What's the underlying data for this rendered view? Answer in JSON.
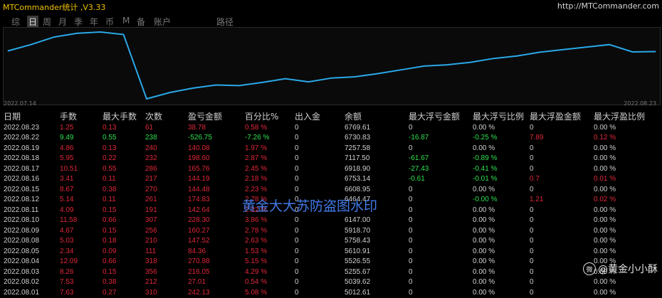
{
  "app": {
    "title": "MTCommander统计 ,V3.33",
    "url": "http://MTCommander.com"
  },
  "tabs": [
    {
      "label": "综",
      "active": false
    },
    {
      "label": "日",
      "active": true
    },
    {
      "label": "周",
      "active": false
    },
    {
      "label": "月",
      "active": false
    },
    {
      "label": "季",
      "active": false
    },
    {
      "label": "年",
      "active": false
    },
    {
      "label": "币",
      "active": false
    },
    {
      "label": "M",
      "active": false
    },
    {
      "label": "备",
      "active": false
    },
    {
      "label": "账户",
      "active": false
    },
    {
      "label": "路径",
      "active": false
    }
  ],
  "chart_data": {
    "type": "line",
    "x": [
      "2022.07.14",
      "2022.07.15",
      "2022.07.18",
      "2022.07.19",
      "2022.07.20",
      "2022.07.21",
      "2022.07.22",
      "2022.07.25",
      "2022.07.26",
      "2022.07.27",
      "2022.07.28",
      "2022.07.29",
      "2022.08.01",
      "2022.08.02",
      "2022.08.03",
      "2022.08.04",
      "2022.08.05",
      "2022.08.08",
      "2022.08.09",
      "2022.08.10",
      "2022.08.11",
      "2022.08.12",
      "2022.08.15",
      "2022.08.16",
      "2022.08.17",
      "2022.08.18",
      "2022.08.19",
      "2022.08.22",
      "2022.08.23"
    ],
    "values": [
      4750,
      4800,
      4860,
      4890,
      4900,
      4880,
      4370,
      4420,
      4455,
      4480,
      4475,
      4500,
      4530,
      4505,
      4535,
      4545,
      4570,
      4600,
      4630,
      4640,
      4660,
      4690,
      4710,
      4740,
      4760,
      4780,
      4800,
      4742,
      4745
    ],
    "x_start_label": "2022.07.14",
    "x_end_label": "2022.08.23",
    "color": "#2aa8e8",
    "grid": false
  },
  "table": {
    "headers": [
      "日期",
      "手数",
      "最大手数",
      "次数",
      "盈亏金额",
      "百分比%",
      "出入金",
      "余额",
      "最大浮亏金额",
      "最大浮亏比例",
      "最大浮盈金额",
      "最大浮盈比例"
    ],
    "rows": [
      [
        {
          "t": "2022.08.23",
          "c": "date"
        },
        {
          "t": "1.25",
          "c": "red"
        },
        {
          "t": "0.13",
          "c": "red"
        },
        {
          "t": "61",
          "c": "red"
        },
        {
          "t": "38.78",
          "c": "red"
        },
        {
          "t": "0.58 %",
          "c": "red"
        },
        {
          "t": "0",
          "c": "white"
        },
        {
          "t": "6769.61",
          "c": "white"
        },
        {
          "t": "0",
          "c": "white"
        },
        {
          "t": "0.00 %",
          "c": "white"
        },
        {
          "t": "0",
          "c": "white"
        },
        {
          "t": "0.00 %",
          "c": "white"
        }
      ],
      [
        {
          "t": "2022.08.22",
          "c": "date"
        },
        {
          "t": "9.49",
          "c": "green"
        },
        {
          "t": "0.55",
          "c": "green"
        },
        {
          "t": "238",
          "c": "green"
        },
        {
          "t": "-526.75",
          "c": "green"
        },
        {
          "t": "-7.26 %",
          "c": "green"
        },
        {
          "t": "0",
          "c": "white"
        },
        {
          "t": "6730.83",
          "c": "white"
        },
        {
          "t": "-16.87",
          "c": "green"
        },
        {
          "t": "-0.25 %",
          "c": "green"
        },
        {
          "t": "7.89",
          "c": "red"
        },
        {
          "t": "0.12 %",
          "c": "red"
        }
      ],
      [
        {
          "t": "2022.08.19",
          "c": "date"
        },
        {
          "t": "4.86",
          "c": "red"
        },
        {
          "t": "0.13",
          "c": "red"
        },
        {
          "t": "240",
          "c": "red"
        },
        {
          "t": "140.08",
          "c": "red"
        },
        {
          "t": "1.97 %",
          "c": "red"
        },
        {
          "t": "0",
          "c": "white"
        },
        {
          "t": "7257.58",
          "c": "white"
        },
        {
          "t": "0",
          "c": "white"
        },
        {
          "t": "0.00 %",
          "c": "white"
        },
        {
          "t": "0",
          "c": "white"
        },
        {
          "t": "0.00 %",
          "c": "white"
        }
      ],
      [
        {
          "t": "2022.08.18",
          "c": "date"
        },
        {
          "t": "5.95",
          "c": "red"
        },
        {
          "t": "0.22",
          "c": "red"
        },
        {
          "t": "232",
          "c": "red"
        },
        {
          "t": "198.60",
          "c": "red"
        },
        {
          "t": "2.87 %",
          "c": "red"
        },
        {
          "t": "0",
          "c": "white"
        },
        {
          "t": "7117.50",
          "c": "white"
        },
        {
          "t": "-61.67",
          "c": "green"
        },
        {
          "t": "-0.89 %",
          "c": "green"
        },
        {
          "t": "0",
          "c": "white"
        },
        {
          "t": "0.00 %",
          "c": "white"
        }
      ],
      [
        {
          "t": "2022.08.17",
          "c": "date"
        },
        {
          "t": "10.51",
          "c": "red"
        },
        {
          "t": "0.55",
          "c": "red"
        },
        {
          "t": "286",
          "c": "red"
        },
        {
          "t": "165.76",
          "c": "red"
        },
        {
          "t": "2.45 %",
          "c": "red"
        },
        {
          "t": "0",
          "c": "white"
        },
        {
          "t": "6918.90",
          "c": "white"
        },
        {
          "t": "-27.43",
          "c": "green"
        },
        {
          "t": "-0.41 %",
          "c": "green"
        },
        {
          "t": "0",
          "c": "white"
        },
        {
          "t": "0.00 %",
          "c": "white"
        }
      ],
      [
        {
          "t": "2022.08.16",
          "c": "date"
        },
        {
          "t": "3.41",
          "c": "red"
        },
        {
          "t": "0.11",
          "c": "red"
        },
        {
          "t": "217",
          "c": "red"
        },
        {
          "t": "144.19",
          "c": "red"
        },
        {
          "t": "2.18 %",
          "c": "red"
        },
        {
          "t": "0",
          "c": "white"
        },
        {
          "t": "6753.14",
          "c": "white"
        },
        {
          "t": "-0.61",
          "c": "green"
        },
        {
          "t": "-0.01 %",
          "c": "green"
        },
        {
          "t": "0.7",
          "c": "red"
        },
        {
          "t": "0.01 %",
          "c": "red"
        }
      ],
      [
        {
          "t": "2022.08.15",
          "c": "date"
        },
        {
          "t": "8.67",
          "c": "red"
        },
        {
          "t": "0.38",
          "c": "red"
        },
        {
          "t": "270",
          "c": "red"
        },
        {
          "t": "144.48",
          "c": "red"
        },
        {
          "t": "2.23 %",
          "c": "red"
        },
        {
          "t": "0",
          "c": "white"
        },
        {
          "t": "6608.95",
          "c": "white"
        },
        {
          "t": "0",
          "c": "white"
        },
        {
          "t": "0.00 %",
          "c": "white"
        },
        {
          "t": "0",
          "c": "white"
        },
        {
          "t": "0.00 %",
          "c": "white"
        }
      ],
      [
        {
          "t": "2022.08.12",
          "c": "date"
        },
        {
          "t": "5.14",
          "c": "red"
        },
        {
          "t": "0.11",
          "c": "red"
        },
        {
          "t": "261",
          "c": "red"
        },
        {
          "t": "174.83",
          "c": "red"
        },
        {
          "t": "2.78 %",
          "c": "red"
        },
        {
          "t": "0",
          "c": "white"
        },
        {
          "t": "6464.47",
          "c": "white"
        },
        {
          "t": "0",
          "c": "white"
        },
        {
          "t": "-0.00 %",
          "c": "green"
        },
        {
          "t": "1.21",
          "c": "red"
        },
        {
          "t": "0.02 %",
          "c": "red"
        }
      ],
      [
        {
          "t": "2022.08.11",
          "c": "date"
        },
        {
          "t": "4.09",
          "c": "red"
        },
        {
          "t": "0.15",
          "c": "red"
        },
        {
          "t": "191",
          "c": "red"
        },
        {
          "t": "142.64",
          "c": "red"
        },
        {
          "t": "2.32 %",
          "c": "red"
        },
        {
          "t": "0",
          "c": "white"
        },
        {
          "t": "",
          "c": "white"
        },
        {
          "t": "0",
          "c": "white"
        },
        {
          "t": "0.00 %",
          "c": "white"
        },
        {
          "t": "0",
          "c": "white"
        },
        {
          "t": "0.00 %",
          "c": "white"
        }
      ],
      [
        {
          "t": "2022.08.10",
          "c": "date"
        },
        {
          "t": "11.58",
          "c": "red"
        },
        {
          "t": "0.66",
          "c": "red"
        },
        {
          "t": "307",
          "c": "red"
        },
        {
          "t": "228.30",
          "c": "red"
        },
        {
          "t": "3.86 %",
          "c": "red"
        },
        {
          "t": "0",
          "c": "white"
        },
        {
          "t": "6147.00",
          "c": "white"
        },
        {
          "t": "0",
          "c": "white"
        },
        {
          "t": "0.00 %",
          "c": "white"
        },
        {
          "t": "0",
          "c": "white"
        },
        {
          "t": "0.00 %",
          "c": "white"
        }
      ],
      [
        {
          "t": "2022.08.09",
          "c": "date"
        },
        {
          "t": "4.67",
          "c": "red"
        },
        {
          "t": "0.15",
          "c": "red"
        },
        {
          "t": "256",
          "c": "red"
        },
        {
          "t": "160.27",
          "c": "red"
        },
        {
          "t": "2.78 %",
          "c": "red"
        },
        {
          "t": "0",
          "c": "white"
        },
        {
          "t": "5918.70",
          "c": "white"
        },
        {
          "t": "0",
          "c": "white"
        },
        {
          "t": "0.00 %",
          "c": "white"
        },
        {
          "t": "0",
          "c": "white"
        },
        {
          "t": "0.00 %",
          "c": "white"
        }
      ],
      [
        {
          "t": "2022.08.08",
          "c": "date"
        },
        {
          "t": "5.03",
          "c": "red"
        },
        {
          "t": "0.18",
          "c": "red"
        },
        {
          "t": "210",
          "c": "red"
        },
        {
          "t": "147.52",
          "c": "red"
        },
        {
          "t": "2.63 %",
          "c": "red"
        },
        {
          "t": "0",
          "c": "white"
        },
        {
          "t": "5758.43",
          "c": "white"
        },
        {
          "t": "0",
          "c": "white"
        },
        {
          "t": "0.00 %",
          "c": "white"
        },
        {
          "t": "0",
          "c": "white"
        },
        {
          "t": "0.00 %",
          "c": "white"
        }
      ],
      [
        {
          "t": "2022.08.05",
          "c": "date"
        },
        {
          "t": "2.34",
          "c": "red"
        },
        {
          "t": "0.09",
          "c": "red"
        },
        {
          "t": "111",
          "c": "red"
        },
        {
          "t": "84.36",
          "c": "red"
        },
        {
          "t": "1.53 %",
          "c": "red"
        },
        {
          "t": "0",
          "c": "white"
        },
        {
          "t": "5610.91",
          "c": "white"
        },
        {
          "t": "0",
          "c": "white"
        },
        {
          "t": "0.00 %",
          "c": "white"
        },
        {
          "t": "0",
          "c": "white"
        },
        {
          "t": "0.00 %",
          "c": "white"
        }
      ],
      [
        {
          "t": "2022.08.04",
          "c": "date"
        },
        {
          "t": "12.09",
          "c": "red"
        },
        {
          "t": "0.66",
          "c": "red"
        },
        {
          "t": "318",
          "c": "red"
        },
        {
          "t": "270.88",
          "c": "red"
        },
        {
          "t": "5.15 %",
          "c": "red"
        },
        {
          "t": "0",
          "c": "white"
        },
        {
          "t": "5526.55",
          "c": "white"
        },
        {
          "t": "0",
          "c": "white"
        },
        {
          "t": "0.00 %",
          "c": "white"
        },
        {
          "t": "0",
          "c": "white"
        },
        {
          "t": "0.00 %",
          "c": "white"
        }
      ],
      [
        {
          "t": "2022.08.03",
          "c": "date"
        },
        {
          "t": "8.26",
          "c": "red"
        },
        {
          "t": "0.15",
          "c": "red"
        },
        {
          "t": "356",
          "c": "red"
        },
        {
          "t": "216.05",
          "c": "red"
        },
        {
          "t": "4.29 %",
          "c": "red"
        },
        {
          "t": "0",
          "c": "white"
        },
        {
          "t": "5255.67",
          "c": "white"
        },
        {
          "t": "0",
          "c": "white"
        },
        {
          "t": "0.00 %",
          "c": "white"
        },
        {
          "t": "0",
          "c": "white"
        },
        {
          "t": "0.00 %",
          "c": "white"
        }
      ],
      [
        {
          "t": "2022.08.02",
          "c": "date"
        },
        {
          "t": "7.53",
          "c": "red"
        },
        {
          "t": "0.38",
          "c": "red"
        },
        {
          "t": "212",
          "c": "red"
        },
        {
          "t": "27.01",
          "c": "red"
        },
        {
          "t": "0.54 %",
          "c": "red"
        },
        {
          "t": "0",
          "c": "white"
        },
        {
          "t": "5039.62",
          "c": "white"
        },
        {
          "t": "0",
          "c": "white"
        },
        {
          "t": "0.00 %",
          "c": "white"
        },
        {
          "t": "0",
          "c": "white"
        },
        {
          "t": "0.00 %",
          "c": "white"
        }
      ],
      [
        {
          "t": "2022.08.01",
          "c": "date"
        },
        {
          "t": "7.63",
          "c": "red"
        },
        {
          "t": "0.27",
          "c": "red"
        },
        {
          "t": "310",
          "c": "red"
        },
        {
          "t": "242.13",
          "c": "red"
        },
        {
          "t": "5.08 %",
          "c": "red"
        },
        {
          "t": "0",
          "c": "white"
        },
        {
          "t": "5012.61",
          "c": "white"
        },
        {
          "t": "0",
          "c": "white"
        },
        {
          "t": "0.00 %",
          "c": "white"
        },
        {
          "t": "0",
          "c": "white"
        },
        {
          "t": "0.00 %",
          "c": "white"
        }
      ]
    ]
  },
  "watermark": {
    "text": "黄金大大苏防盗图水印"
  },
  "weibo": {
    "logo": "微",
    "handle": "@黄金小小酥"
  }
}
